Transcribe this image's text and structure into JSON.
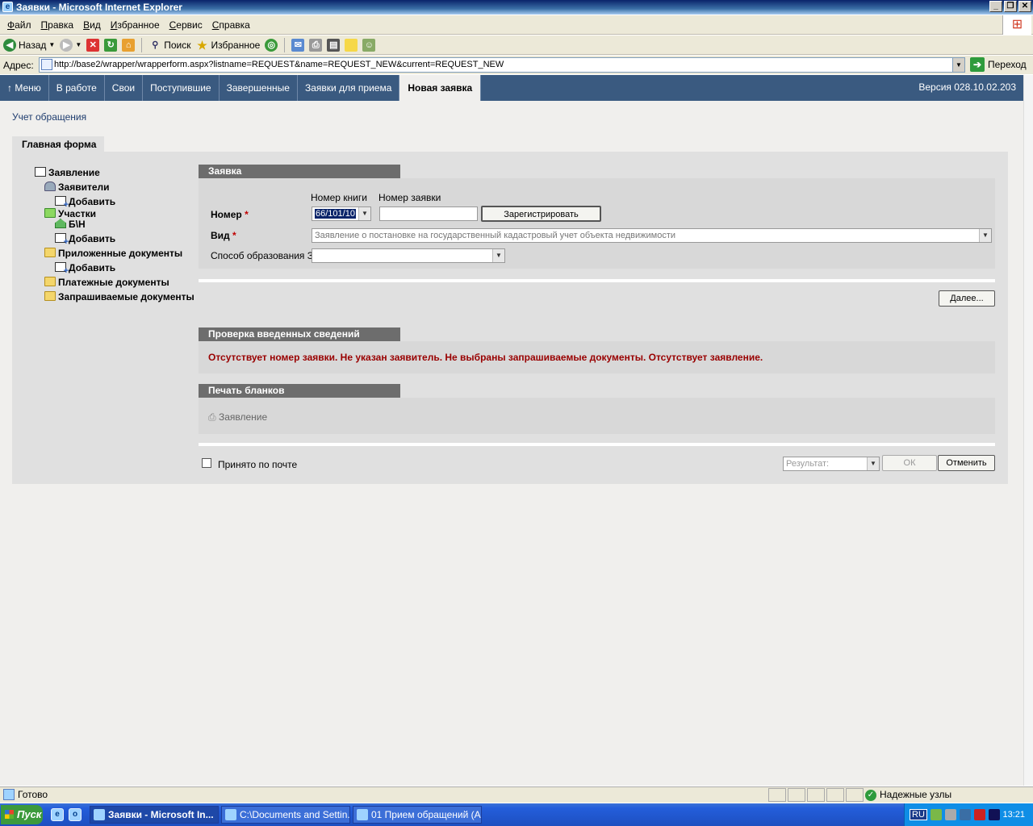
{
  "window": {
    "title": "Заявки - Microsoft Internet Explorer"
  },
  "menu": [
    "Файл",
    "Правка",
    "Вид",
    "Избранное",
    "Сервис",
    "Справка"
  ],
  "toolbar": {
    "back": "Назад",
    "search": "Поиск",
    "favorites": "Избранное"
  },
  "address": {
    "label": "Адрес:",
    "url": "http://base2/wrapper/wrapperform.aspx?listname=REQUEST&name=REQUEST_NEW&current=REQUEST_NEW",
    "go": "Переход"
  },
  "nav": {
    "items": [
      "Меню",
      "В работе",
      "Свои",
      "Поступившие",
      "Завершенные",
      "Заявки для приема",
      "Новая заявка"
    ],
    "version": "Версия 028.10.02.203"
  },
  "page": {
    "title": "Учет обращения",
    "tab": "Главная форма"
  },
  "tree": {
    "statement": "Заявление",
    "applicants": "Заявители",
    "add1": "Добавить",
    "plots": "Участки",
    "plot_bn": "Б\\Н",
    "add2": "Добавить",
    "attached": "Приложенные документы",
    "add3": "Добавить",
    "payment": "Платежные документы",
    "requested": "Запрашиваемые документы"
  },
  "request": {
    "header": "Заявка",
    "book_no_label": "Номер книги",
    "req_no_label": "Номер заявки",
    "number_label": "Номер",
    "book_value": "66/101/10",
    "register_btn": "Зарегистрировать",
    "kind_label": "Вид",
    "kind_value": "Заявление о постановке на государственный кадастровый учет объекта недвижимости",
    "method_label": "Способ образования ЗУ",
    "next_btn": "Далее..."
  },
  "check": {
    "header": "Проверка введенных сведений",
    "error": "Отсутствует номер заявки. Не указан заявитель. Не выбраны запрашиваемые документы. Отсутствует заявление."
  },
  "print": {
    "header": "Печать бланков",
    "link": "Заявление"
  },
  "footer": {
    "by_mail": "Принято по почте",
    "result_placeholder": "Результат:",
    "ok": "ОК",
    "cancel": "Отменить"
  },
  "status": {
    "text": "Готово",
    "zone": "Надежные узлы"
  },
  "taskbar": {
    "start": "Пуск",
    "tasks": [
      "Заявки - Microsoft In...",
      "C:\\Documents and Settin...",
      "01 Прием обращений (А..."
    ],
    "lang": "RU",
    "time": "13:21"
  }
}
